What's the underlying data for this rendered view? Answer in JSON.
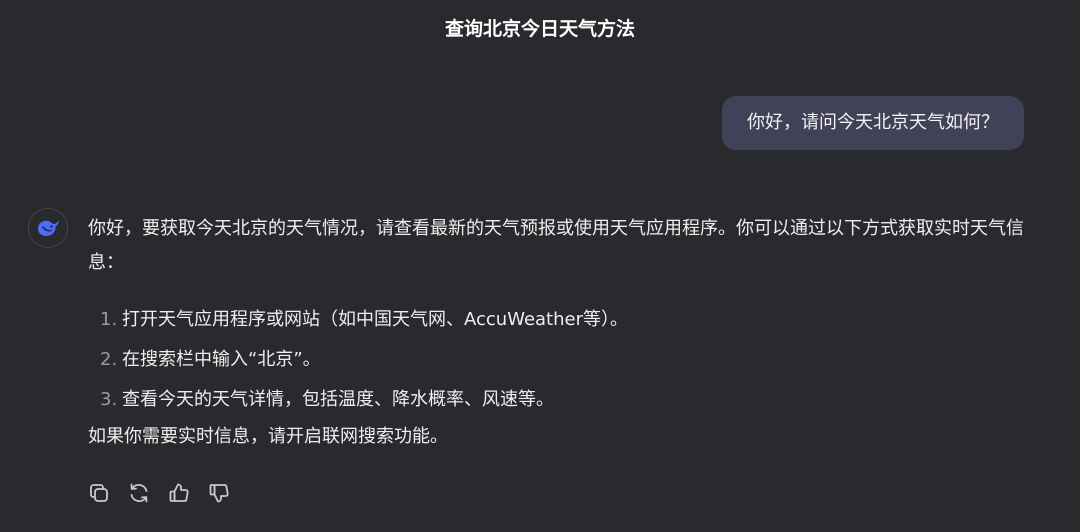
{
  "header": {
    "title": "查询北京今日天气方法"
  },
  "conversation": {
    "user_message": "你好，请问今天北京天气如何？",
    "assistant": {
      "avatar_icon": "whale-logo-icon",
      "intro": "你好，要获取今天北京的天气情况，请查看最新的天气预报或使用天气应用程序。你可以通过以下方式获取实时天气信息：",
      "steps": [
        {
          "num": "1.",
          "text": "打开天气应用程序或网站（如中国天气网、AccuWeather等）。"
        },
        {
          "num": "2.",
          "text": "在搜索栏中输入“北京”。"
        },
        {
          "num": "3.",
          "text": "查看今天的天气详情，包括温度、降水概率、风速等。"
        }
      ],
      "outro": "如果你需要实时信息，请开启联网搜索功能。"
    }
  },
  "actions": [
    {
      "icon": "copy-icon"
    },
    {
      "icon": "regenerate-icon"
    },
    {
      "icon": "thumbs-up-icon"
    },
    {
      "icon": "thumbs-down-icon"
    }
  ],
  "colors": {
    "background": "#292a2d",
    "user_bubble": "#414158",
    "accent": "#4d6bfe"
  }
}
